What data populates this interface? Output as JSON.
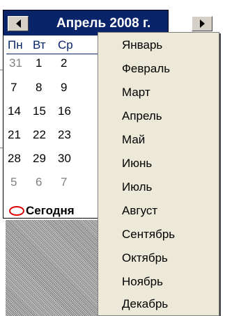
{
  "calendar": {
    "title": "Апрель 2008 г.",
    "dow": [
      "Пн",
      "Вт",
      "Ср"
    ],
    "weeks": [
      [
        "31",
        "1",
        "2"
      ],
      [
        "7",
        "8",
        "9"
      ],
      [
        "14",
        "15",
        "16"
      ],
      [
        "21",
        "22",
        "23"
      ],
      [
        "28",
        "29",
        "30"
      ],
      [
        "5",
        "6",
        "7"
      ]
    ],
    "today_label": "Сегодня"
  },
  "month_menu": {
    "items": [
      "Январь",
      "Февраль",
      "Март",
      "Апрель",
      "Май",
      "Июнь",
      "Июль",
      "Август",
      "Сентябрь",
      "Октябрь",
      "Ноябрь",
      "Декабрь"
    ]
  },
  "colors": {
    "header_bg": "#0a246a",
    "menu_bg": "#ece9d8",
    "today_ring": "#e00000"
  }
}
